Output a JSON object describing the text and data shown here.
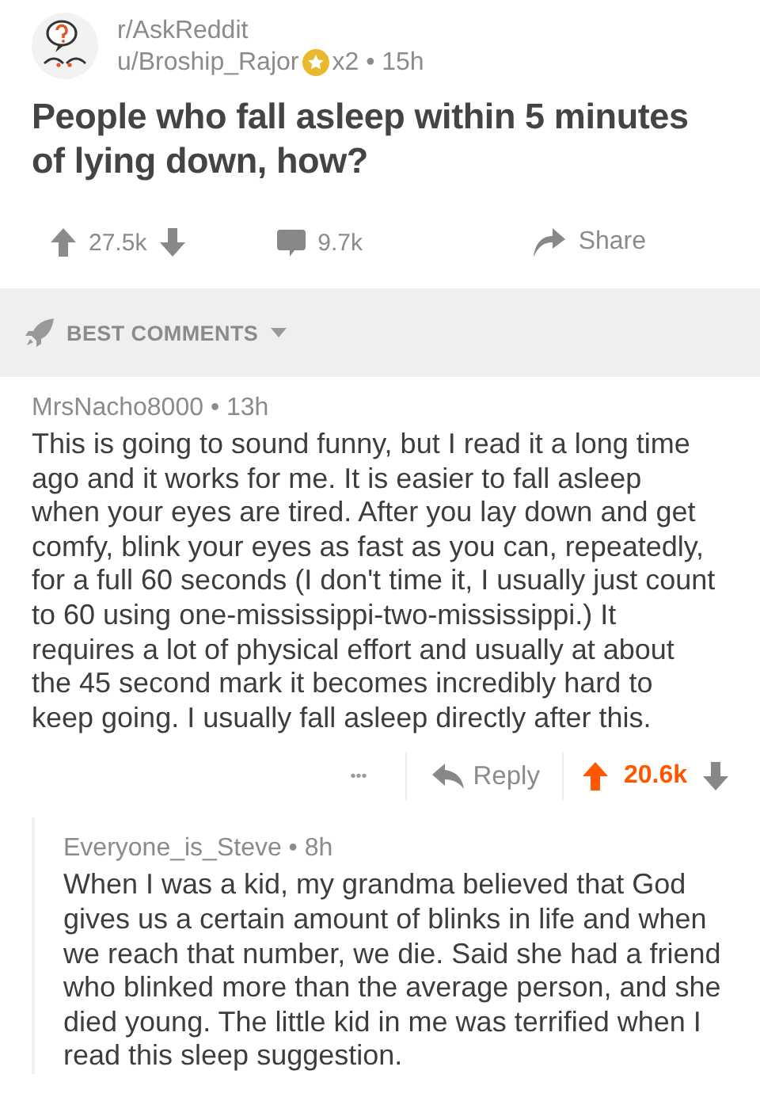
{
  "post": {
    "subreddit": "r/AskReddit",
    "author": "u/Broship_Rajor",
    "award_line": "x2 • 15h",
    "title": "People who fall asleep within 5 minutes of lying down, how?",
    "score": "27.5k",
    "upvoted": false,
    "comments": "9.7k",
    "share": "Share"
  },
  "sort": {
    "label": "BEST COMMENTS"
  },
  "comments": [
    {
      "meta": "MrsNacho8000 • 13h",
      "body": "This is going to sound funny, but I read it a long time ago and it works for me. It is easier to fall asleep when your eyes are tired. After you lay down and get comfy, blink your eyes as fast as you can, repeatedly, for a full 60 seconds (I don't time it, I usually just count to 60 using one-mississippi-two-mississippi.) It requires a lot of physical effort and usually at about the 45 second mark it becomes incredibly hard to keep going. I usually fall asleep directly after this.",
      "more": "•••",
      "reply": "Reply",
      "score": "20.6k",
      "upvoted": true,
      "children": [
        {
          "meta": "Everyone_is_Steve • 8h",
          "body": "When I was a kid, my grandma believed that God gives us a certain amount of blinks in life and when we reach that number, we die. Said she had a friend who blinked more than the average person, and she died young. The little kid in me was terrified when I read this sleep suggestion."
        }
      ]
    }
  ]
}
